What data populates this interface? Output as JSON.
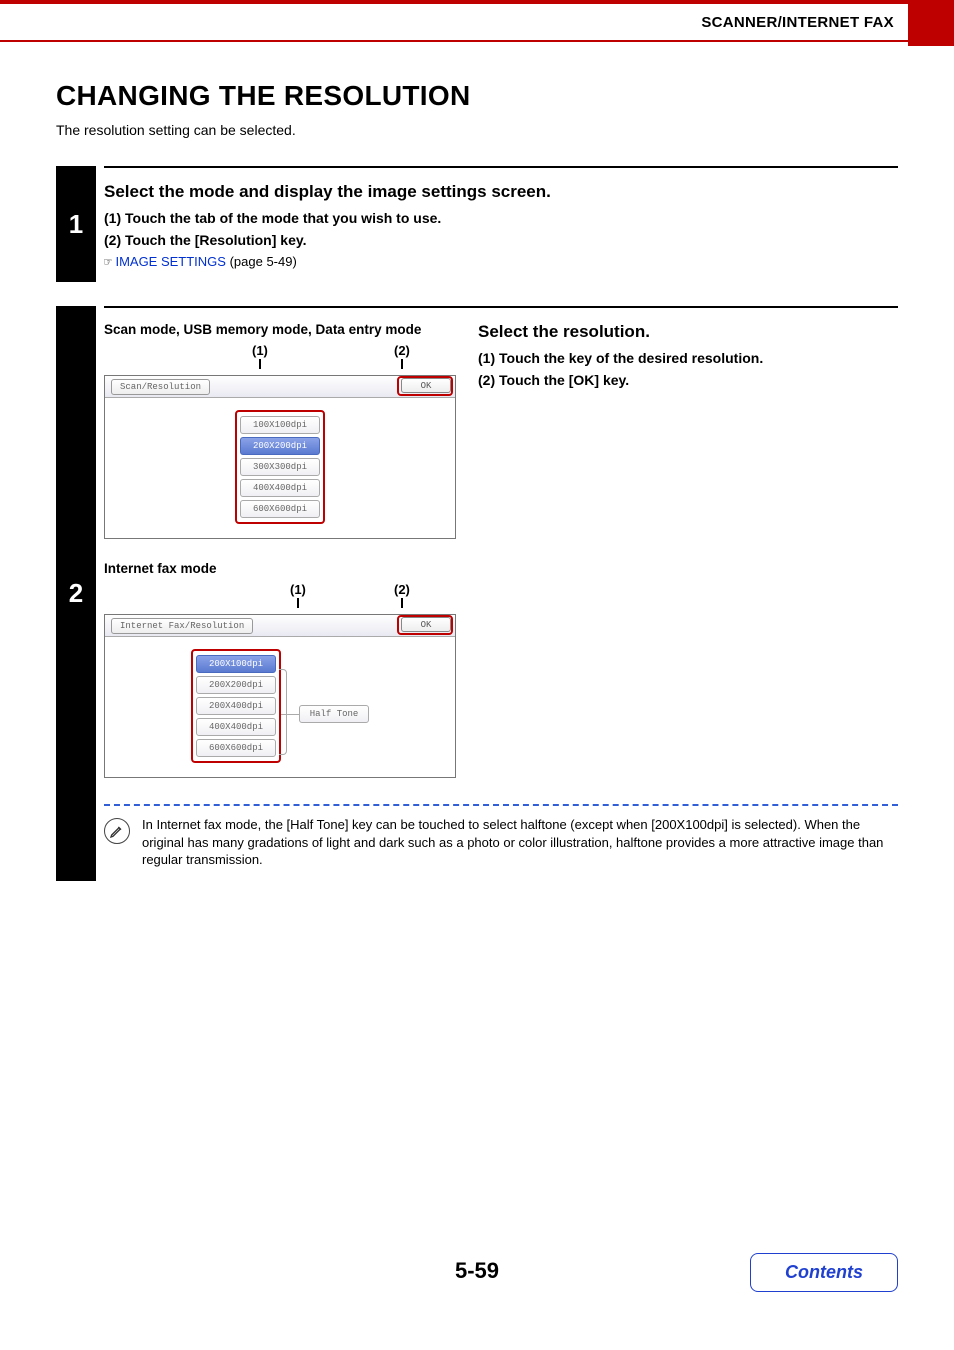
{
  "header": {
    "breadcrumb": "SCANNER/INTERNET FAX"
  },
  "title": "CHANGING THE RESOLUTION",
  "intro": "The resolution setting can be selected.",
  "step1": {
    "number": "1",
    "heading": "Select the mode and display the image settings screen.",
    "item1": "(1)  Touch the tab of the mode that you wish to use.",
    "item2": "(2)  Touch the [Resolution] key.",
    "ref_icon": "☞",
    "xref": "IMAGE SETTINGS",
    "xref_suffix": " (page 5-49)"
  },
  "step2": {
    "number": "2",
    "mode_a_label": "Scan mode, USB memory mode, Data entry mode",
    "mode_b_label": "Internet fax mode",
    "callout1": "(1)",
    "callout2": "(2)",
    "panel_a": {
      "title": "Scan/Resolution",
      "ok": "OK",
      "options": [
        "100X100dpi",
        "200X200dpi",
        "300X300dpi",
        "400X400dpi",
        "600X600dpi"
      ],
      "selected_index": 1
    },
    "panel_b": {
      "title": "Internet Fax/Resolution",
      "ok": "OK",
      "options": [
        "200X100dpi",
        "200X200dpi",
        "200X400dpi",
        "400X400dpi",
        "600X600dpi"
      ],
      "selected_index": 0,
      "halftone": "Half Tone"
    },
    "right_heading": "Select the resolution.",
    "right_item1": "(1)  Touch the key of the desired resolution.",
    "right_item2": "(2)  Touch the [OK] key.",
    "note": "In Internet fax mode, the [Half Tone] key can be touched to select halftone (except when [200X100dpi] is selected). When the original has many gradations of light and dark such as a photo or color illustration, halftone provides a more attractive image than regular transmission."
  },
  "footer": {
    "page_number": "5-59",
    "contents": "Contents"
  }
}
